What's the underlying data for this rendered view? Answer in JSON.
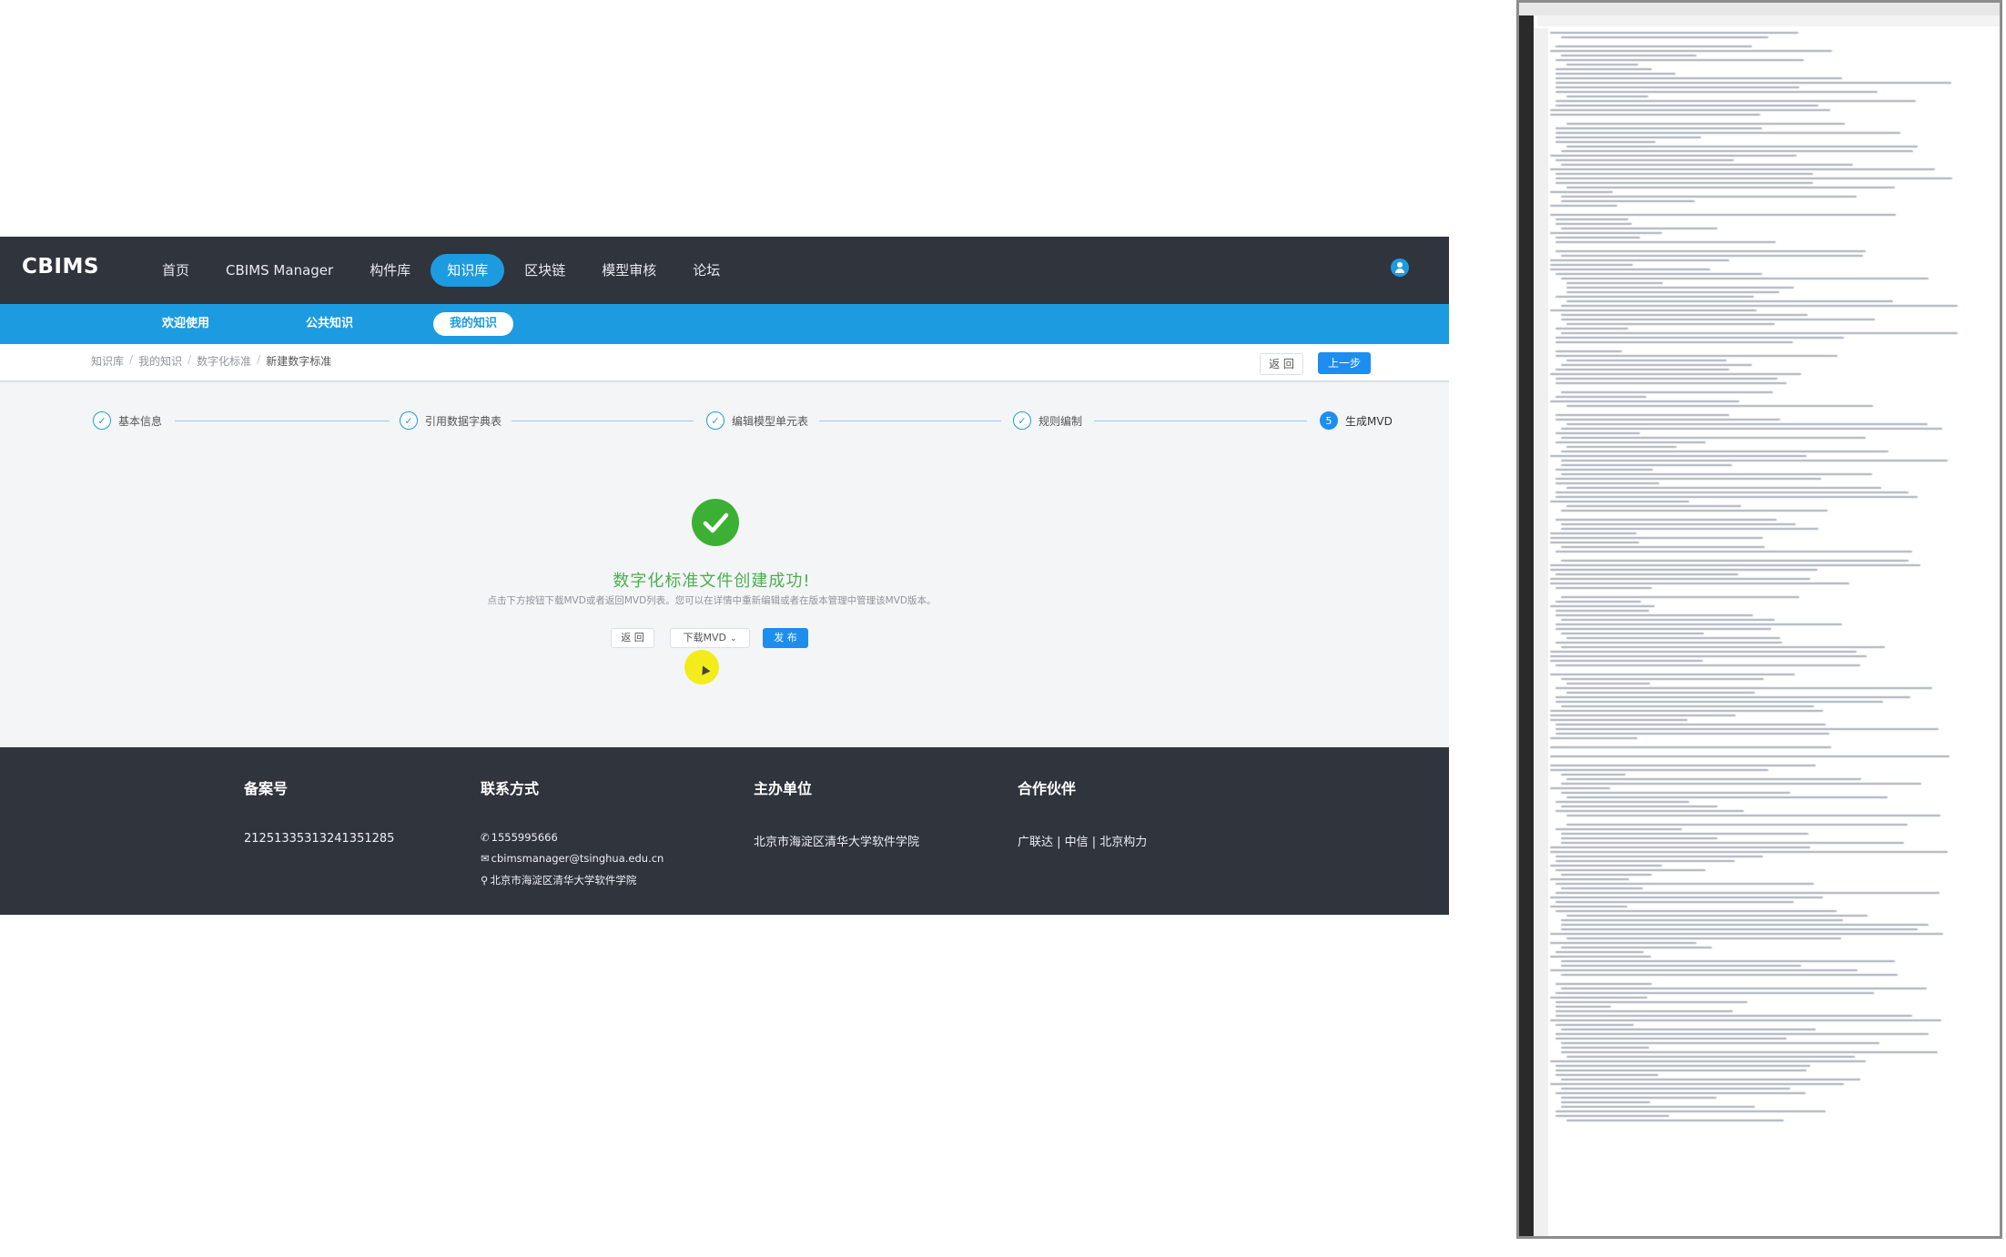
{
  "app": {
    "brand": "CBIMS",
    "nav": [
      {
        "label": "首页",
        "active": false
      },
      {
        "label": "CBIMS Manager",
        "active": false
      },
      {
        "label": "构件库",
        "active": false
      },
      {
        "label": "知识库",
        "active": true
      },
      {
        "label": "区块链",
        "active": false
      },
      {
        "label": "模型审核",
        "active": false
      },
      {
        "label": "论坛",
        "active": false
      }
    ],
    "subnav": [
      {
        "label": "欢迎使用",
        "active": false
      },
      {
        "label": "公共知识",
        "active": false
      },
      {
        "label": "我的知识",
        "active": true
      }
    ],
    "breadcrumb": [
      "知识库",
      "我的知识",
      "数字化标准",
      "新建数字标准"
    ],
    "breadcrumb_separator": "/",
    "crumb_actions": {
      "back": "返 回",
      "prev": "上一步"
    },
    "steps": [
      {
        "label": "基本信息",
        "status": "done"
      },
      {
        "label": "引用数据字典表",
        "status": "done"
      },
      {
        "label": "编辑模型单元表",
        "status": "done"
      },
      {
        "label": "规则编制",
        "status": "done"
      },
      {
        "label": "生成MVD",
        "status": "current",
        "number": "5"
      }
    ],
    "result": {
      "title": "数字化标准文件创建成功!",
      "subtitle": "点击下方按钮下载MVD或者返回MVD列表。您可以在详情中重新编辑或者在版本管理中管理该MVD版本。",
      "actions": {
        "back": "返 回",
        "download": "下载MVD",
        "publish": "发 布"
      }
    },
    "footer": {
      "record": {
        "heading": "备案号",
        "value": "21251335313241351285"
      },
      "contact": {
        "heading": "联系方式",
        "phone": "1555995666",
        "email": "cbimsmanager@tsinghua.edu.cn",
        "address": "北京市海淀区清华大学软件学院"
      },
      "host": {
        "heading": "主办单位",
        "value": "北京市海淀区清华大学软件学院"
      },
      "partners": {
        "heading": "合作伙伴",
        "value": "广联达 | 中信 | 北京构力"
      }
    },
    "colors": {
      "nav_bg": "#2f343d",
      "accent": "#1d9be0",
      "primary_button": "#1d8df0",
      "success": "#3cb034"
    },
    "icons": [
      "user-icon",
      "check-icon",
      "chevron-down-icon",
      "phone-icon",
      "mail-icon",
      "location-icon"
    ]
  }
}
